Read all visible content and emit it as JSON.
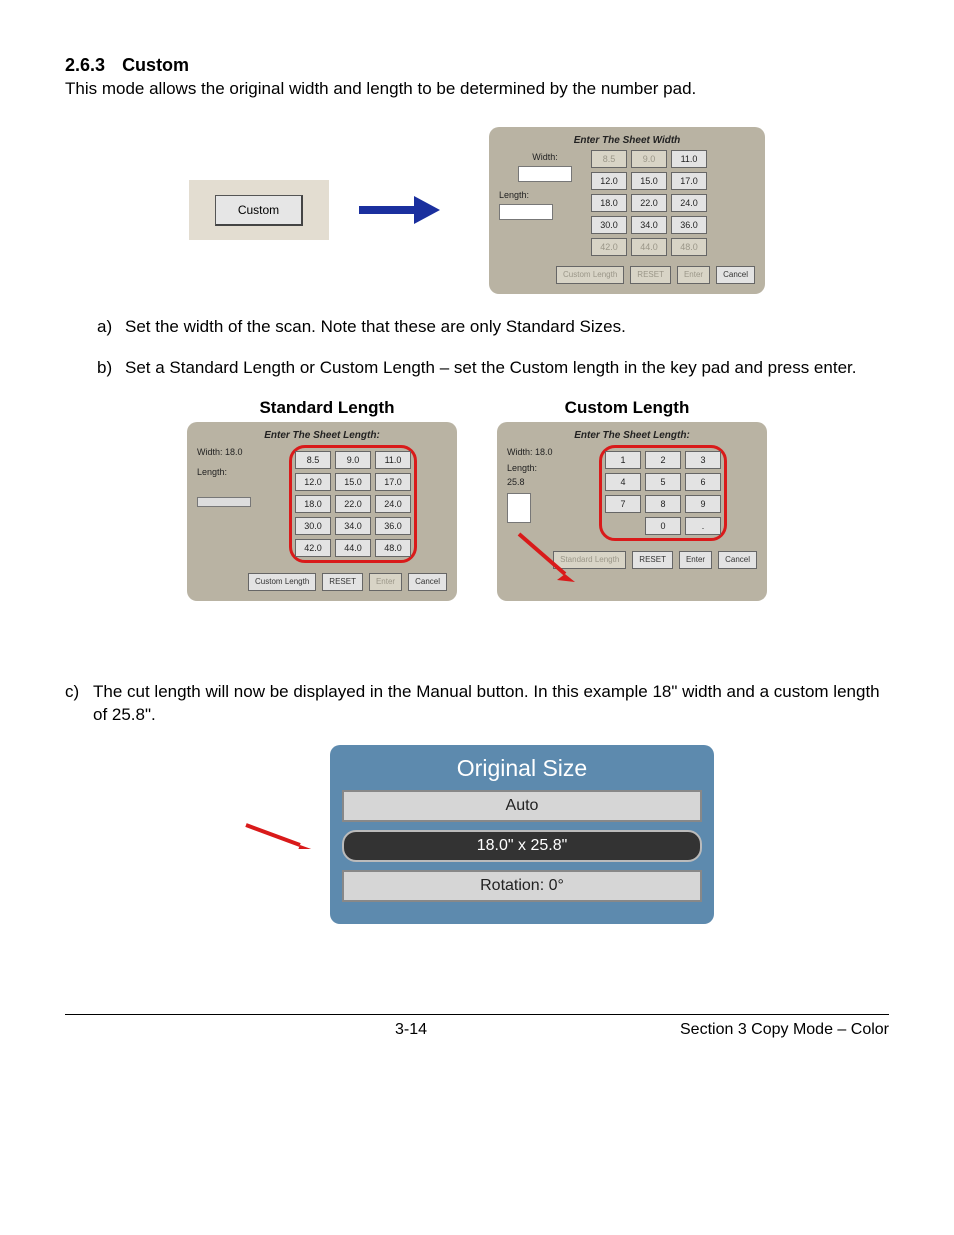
{
  "heading_num": "2.6.3",
  "heading_title": "Custom",
  "intro": "This mode allows the original width and length to be determined by the number pad.",
  "custom_button_label": "Custom",
  "width_panel": {
    "title": "Enter The Sheet Width",
    "width_label": "Width:",
    "length_label": "Length:",
    "values": [
      "8.5",
      "9.0",
      "11.0",
      "12.0",
      "15.0",
      "17.0",
      "18.0",
      "22.0",
      "24.0",
      "30.0",
      "34.0",
      "36.0",
      "42.0",
      "44.0",
      "48.0"
    ],
    "disabled_values": [
      "8.5",
      "9.0",
      "42.0",
      "44.0",
      "48.0"
    ],
    "bottom_buttons": [
      "Custom Length",
      "RESET",
      "Enter",
      "Cancel"
    ]
  },
  "step_a": "Set the width of the scan. Note that these are only Standard Sizes.",
  "step_b": "Set a Standard Length or Custom Length – set the Custom length in the key pad and press enter.",
  "std_heading": "Standard Length",
  "cust_heading": "Custom Length",
  "std_panel": {
    "title": "Enter The Sheet Length:",
    "width_line": "Width:  18.0",
    "length_label": "Length:",
    "values": [
      "8.5",
      "9.0",
      "11.0",
      "12.0",
      "15.0",
      "17.0",
      "18.0",
      "22.0",
      "24.0",
      "30.0",
      "34.0",
      "36.0",
      "42.0",
      "44.0",
      "48.0"
    ],
    "bottom_buttons": [
      "Custom Length",
      "RESET",
      "Enter",
      "Cancel"
    ]
  },
  "cust_panel": {
    "title": "Enter The Sheet Length:",
    "width_line": "Width:  18.0",
    "length_label": "Length:",
    "length_value": "25.8",
    "keys": [
      "1",
      "2",
      "3",
      "4",
      "5",
      "6",
      "7",
      "8",
      "9",
      "",
      "0",
      "."
    ],
    "bottom_buttons": [
      "Standard Length",
      "RESET",
      "Enter",
      "Cancel"
    ]
  },
  "step_c": "The cut length will now be displayed in the Manual button. In this example 18\" width and a custom length of 25.8\".",
  "orig": {
    "title": "Original Size",
    "auto": "Auto",
    "size": "18.0\" x 25.8\"",
    "rotation": "Rotation: 0°"
  },
  "footer_page": "3-14",
  "footer_section": "Section 3    Copy Mode – Color"
}
